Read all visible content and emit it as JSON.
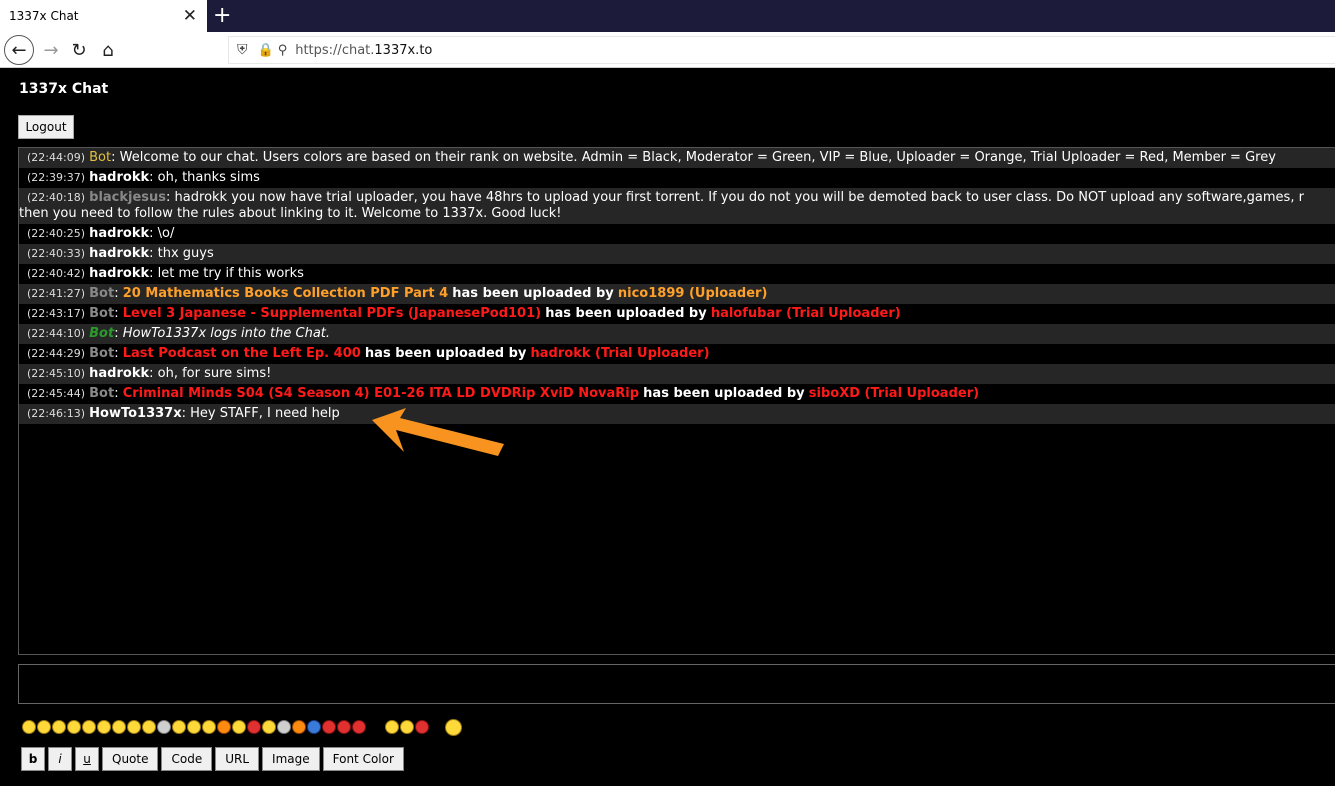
{
  "browser": {
    "tab_title": "1337x Chat",
    "tab_close": "✕",
    "new_tab": "+",
    "url_prefix": "https://chat.",
    "url_domain": "1337x.to"
  },
  "page": {
    "title": "1337x Chat",
    "logout_label": "Logout"
  },
  "messages": [
    {
      "ts": "(22:44:09)",
      "user": "Bot",
      "text": "Welcome to our chat. Users colors are based on their rank on website. Admin = Black, Moderator = Green, VIP = Blue, Uploader = Orange, Trial Uploader = Red, Member = Grey"
    },
    {
      "ts": "(22:39:37)",
      "user": "hadrokk",
      "text": "oh, thanks sims"
    },
    {
      "ts": "(22:40:18)",
      "user": "blackjesus",
      "text": "hadrokk you now have trial uploader, you have 48hrs to upload your first torrent. If you do not you will be demoted back to user class. Do NOT upload any software,games, r",
      "text2": "then you need to follow the rules about linking to it. Welcome to 1337x. Good luck!"
    },
    {
      "ts": "(22:40:25)",
      "user": "hadrokk",
      "text": "\\o/"
    },
    {
      "ts": "(22:40:33)",
      "user": "hadrokk",
      "text": "thx guys"
    },
    {
      "ts": "(22:40:42)",
      "user": "hadrokk",
      "text": "let me try if this works"
    },
    {
      "ts": "(22:41:27)",
      "user": "Bot",
      "title": "20 Mathematics Books Collection PDF Part 4",
      "middle": "has been uploaded by",
      "uploader": "nico1899 (Uploader)"
    },
    {
      "ts": "(22:43:17)",
      "user": "Bot",
      "title": "Level 3 Japanese - Supplemental PDFs (JapanesePod101)",
      "middle": "has been uploaded by",
      "uploader": "halofubar (Trial Uploader)"
    },
    {
      "ts": "(22:44:10)",
      "user": "Bot",
      "text": "HowTo1337x logs into the Chat."
    },
    {
      "ts": "(22:44:29)",
      "user": "Bot",
      "title": "Last Podcast on the Left Ep. 400",
      "middle": "has been uploaded by",
      "uploader": "hadrokk (Trial Uploader)"
    },
    {
      "ts": "(22:45:10)",
      "user": "hadrokk",
      "text": "oh, for sure sims!"
    },
    {
      "ts": "(22:45:44)",
      "user": "Bot",
      "title": "Criminal Minds S04 (S4 Season 4) E01-26 ITA LD DVDRip XviD NovaRip",
      "middle": "has been uploaded by",
      "uploader": "siboXD (Trial Uploader)"
    },
    {
      "ts": "(22:46:13)",
      "user": "HowTo1337x",
      "text": "Hey STAFF, I need help"
    }
  ],
  "format_buttons": {
    "bold": "b",
    "italic": "i",
    "underline": "u",
    "quote": "Quote",
    "code": "Code",
    "url": "URL",
    "image": "Image",
    "font_color": "Font Color"
  },
  "colors": {
    "uploader": "#ffa02a",
    "trial_uploader": "#ff1a1a",
    "bot_green": "#2a9a2a",
    "annotation_arrow": "#f7931e"
  }
}
